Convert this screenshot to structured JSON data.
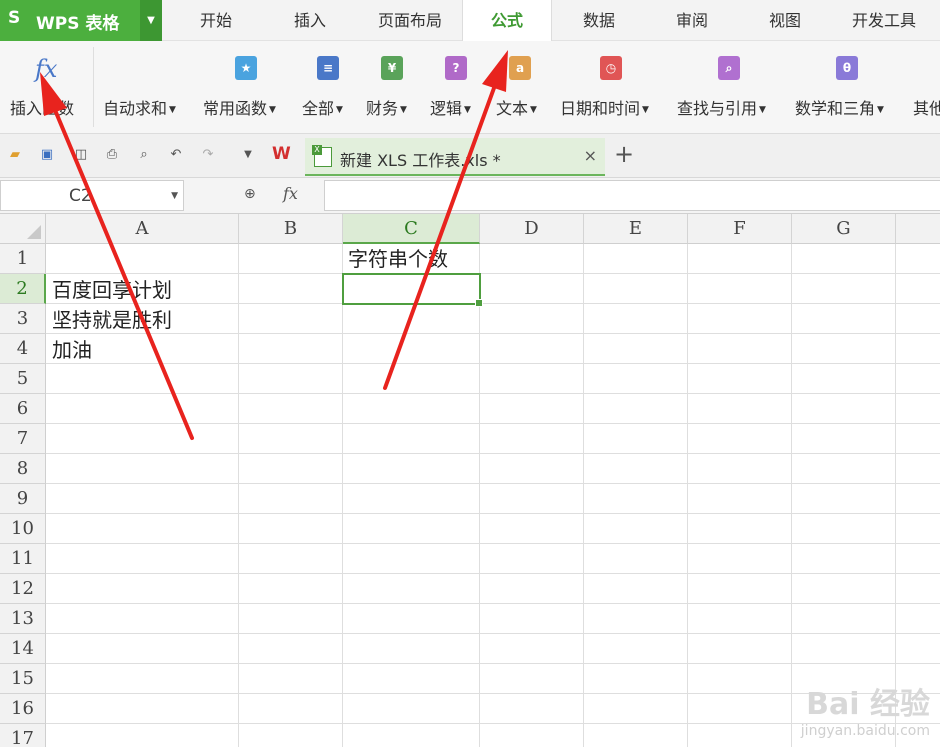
{
  "app": {
    "logo_s": "S",
    "name": "WPS 表格"
  },
  "menu_tabs": [
    "开始",
    "插入",
    "页面布局",
    "公式",
    "数据",
    "审阅",
    "视图",
    "开发工具"
  ],
  "active_menu_tab": "公式",
  "ribbon": {
    "insert_function": "插入函数",
    "autosum": "自动求和",
    "common": "常用函数",
    "all": "全部",
    "finance": "财务",
    "logic": "逻辑",
    "text": "文本",
    "datetime": "日期和时间",
    "lookup": "查找与引用",
    "math": "数学和三角",
    "other": "其他"
  },
  "ribbon_icon_colors": {
    "common": "#4aa3df",
    "all": "#4a78c8",
    "finance": "#5aa35a",
    "logic": "#b06ac8",
    "text": "#e0a050",
    "datetime": "#e05555",
    "lookup": "#b070d0",
    "math": "#8a7ad8"
  },
  "doc_tab": {
    "title": "新建 XLS 工作表.xls *",
    "close": "×",
    "new": "+"
  },
  "wps_logo": "W",
  "formula_bar": {
    "cell_ref": "C2",
    "fx": "fx"
  },
  "columns": [
    "A",
    "B",
    "C",
    "D",
    "E",
    "F",
    "G"
  ],
  "rows": [
    "1",
    "2",
    "3",
    "4",
    "5",
    "6",
    "7",
    "8",
    "9",
    "10",
    "11",
    "12",
    "13",
    "14",
    "15",
    "16",
    "17"
  ],
  "selected_column": "C",
  "selected_row": "2",
  "cells": {
    "C1": "字符串个数",
    "A2": "百度回享计划",
    "A3": "坚持就是胜利",
    "A4": "加油"
  },
  "watermark": {
    "brand": "Bai 经验",
    "url": "jingyan.baidu.com"
  },
  "accent_color": "#4caf3e",
  "annotation_color": "#e8231e"
}
